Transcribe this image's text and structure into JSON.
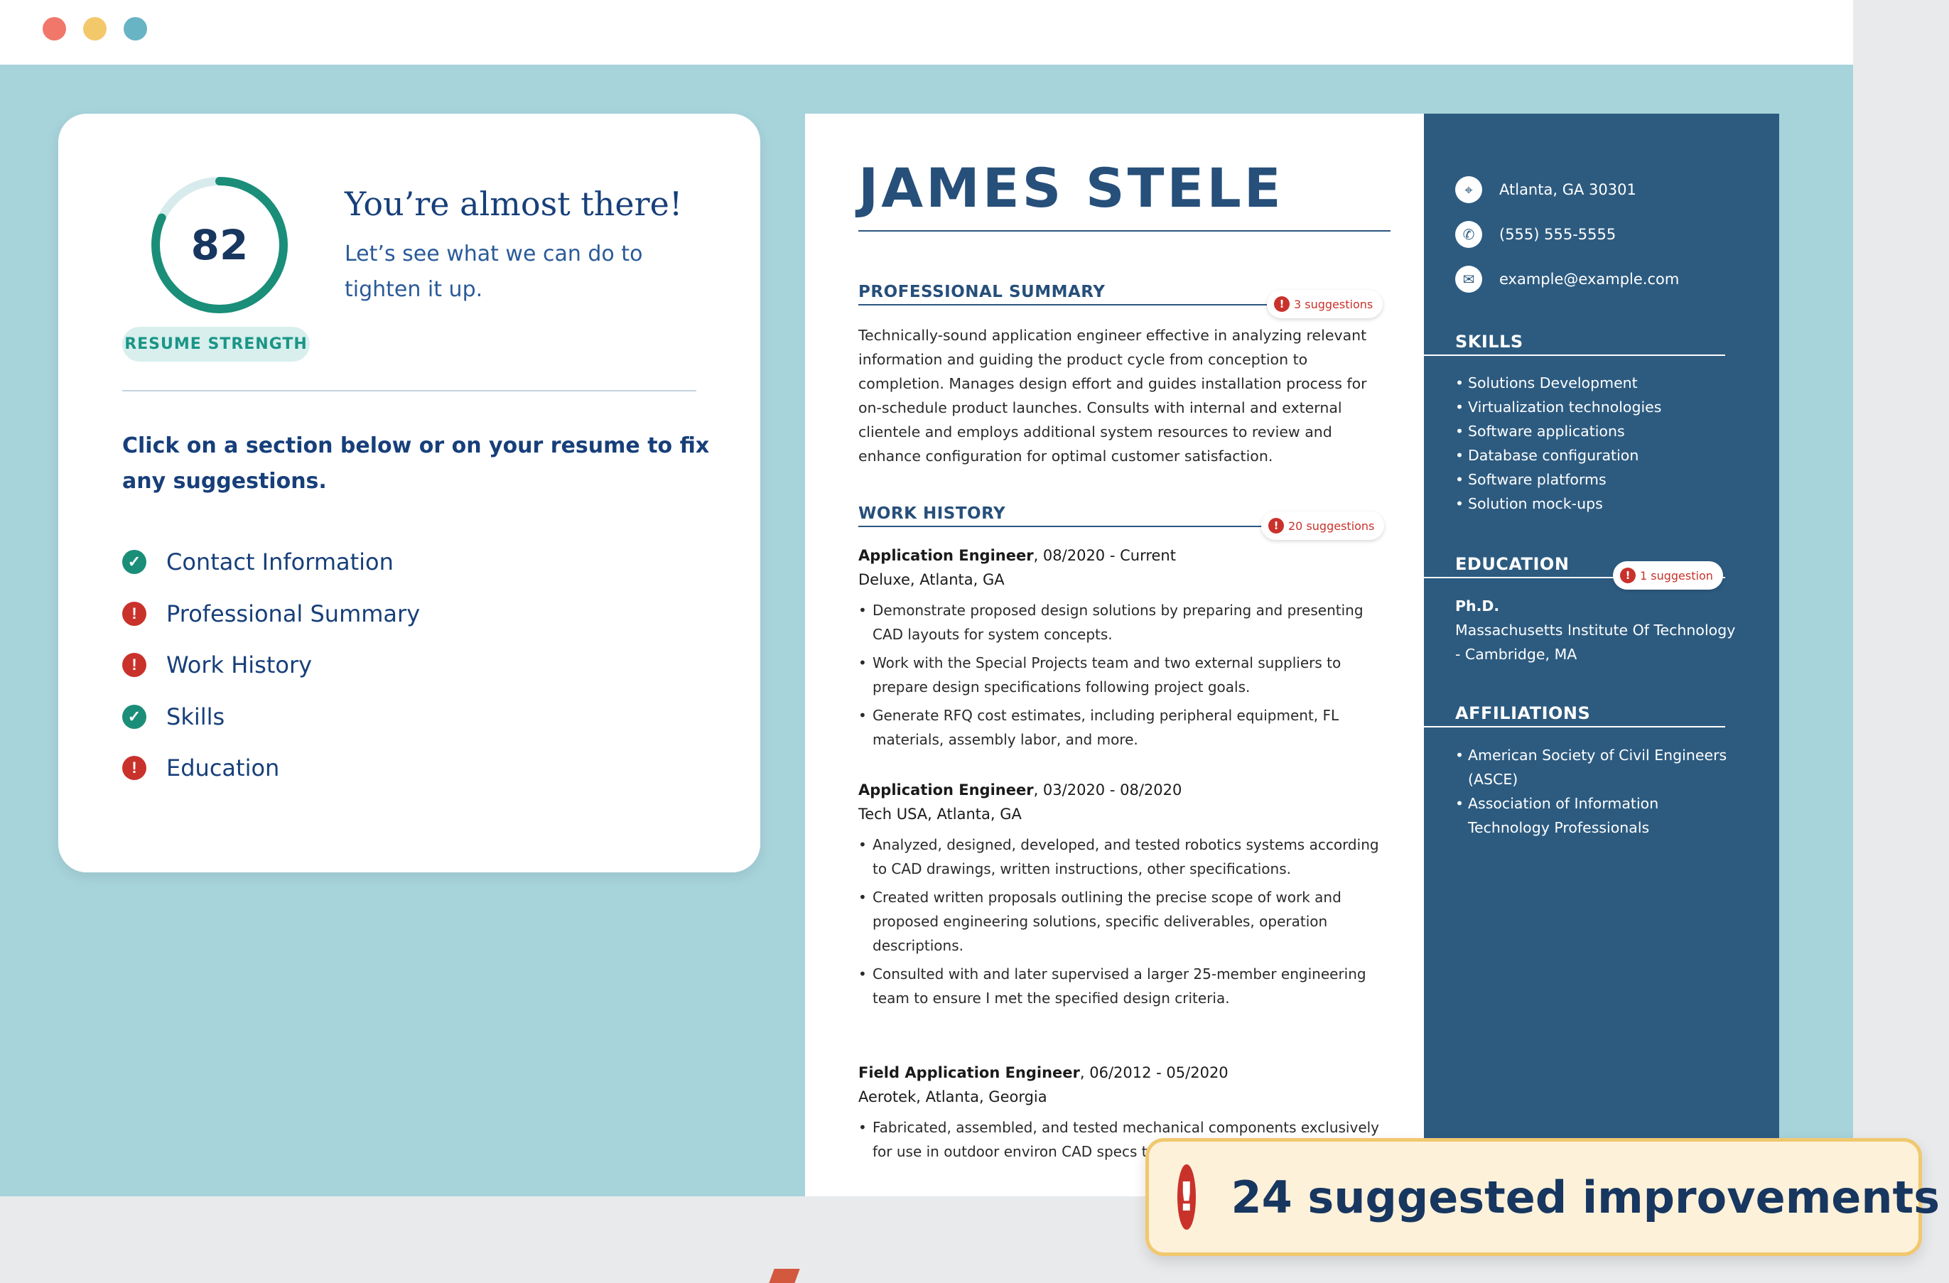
{
  "window": {
    "colors": {
      "background": "#a7d3db",
      "accent": "#173660",
      "ok": "#1a8e78",
      "warn": "#c9322b",
      "sidebar": "#2d5b80"
    }
  },
  "score_card": {
    "score": "82",
    "score_fraction": 0.82,
    "strength_label": "RESUME STRENGTH",
    "headline": "You’re almost there!",
    "subtext": "Let’s see what we can do to tighten it up.",
    "instruction": "Click on a section below or on your resume to fix any suggestions.",
    "sections": [
      {
        "label": "Contact Information",
        "status": "ok",
        "icon": "check-icon"
      },
      {
        "label": "Professional Summary",
        "status": "warn",
        "icon": "alert-icon"
      },
      {
        "label": "Work History",
        "status": "warn",
        "icon": "alert-icon"
      },
      {
        "label": "Skills",
        "status": "ok",
        "icon": "check-icon"
      },
      {
        "label": "Education",
        "status": "warn",
        "icon": "alert-icon"
      }
    ]
  },
  "resume": {
    "name": "JAMES  STELE",
    "summary": {
      "heading": "PROFESSIONAL SUMMARY",
      "suggestions": "3 suggestions",
      "text": "Technically-sound application engineer effective in analyzing relevant information and guiding the product cycle from conception to completion. Manages design effort and guides installation process for on-schedule product launches. Consults with internal and external clientele and employs additional system resources to review and enhance configuration for optimal customer satisfaction."
    },
    "work": {
      "heading": "WORK HISTORY",
      "suggestions": "20 suggestions",
      "jobs": [
        {
          "title": "Application Engineer",
          "dates": ", 08/2020 - Current",
          "location": "Deluxe, Atlanta, GA",
          "bullets": [
            "Demonstrate proposed design solutions by preparing and presenting CAD layouts for system concepts.",
            "Work with the Special Projects team and two external suppliers to prepare design specifications following project goals.",
            "Generate RFQ cost estimates, including peripheral equipment, FL materials, assembly labor, and more."
          ]
        },
        {
          "title": "Application Engineer",
          "dates": ", 03/2020 - 08/2020",
          "location": "Tech USA, Atlanta, GA",
          "bullets": [
            "Analyzed, designed, developed, and tested robotics systems according to CAD drawings, written instructions, other specifications.",
            "Created written proposals outlining the precise scope of work and proposed engineering solutions, specific deliverables, operation descriptions.",
            "Consulted with and later supervised a larger 25-member engineering team to ensure I met the specified design criteria."
          ]
        },
        {
          "title": "Field Application Engineer",
          "dates": ", 06/2012 - 05/2020",
          "location": "Aerotek, Atlanta, Georgia",
          "bullets": [
            "Fabricated, assembled, and tested mechanical components exclusively for use in outdoor environ CAD specs to mechanical engineers."
          ]
        }
      ]
    },
    "contact": {
      "address": "Atlanta, GA 30301",
      "phone": "(555) 555-5555",
      "email": "example@example.com"
    },
    "skills": {
      "heading": "SKILLS",
      "items": [
        "Solutions Development",
        "Virtualization technologies",
        "Software applications",
        "Database configuration",
        "Software platforms",
        "Solution mock-ups"
      ]
    },
    "education": {
      "heading": "EDUCATION",
      "suggestions": "1 suggestion",
      "degree": "Ph.D.",
      "school": "Massachusetts Institute Of Technology - Cambridge, MA"
    },
    "affiliations": {
      "heading": "AFFILIATIONS",
      "items": [
        "American Society of Civil Engineers (ASCE)",
        "Association of Information Technology Professionals"
      ]
    }
  },
  "banner": {
    "text": "24 suggested improvements",
    "icon": "alert-icon"
  }
}
